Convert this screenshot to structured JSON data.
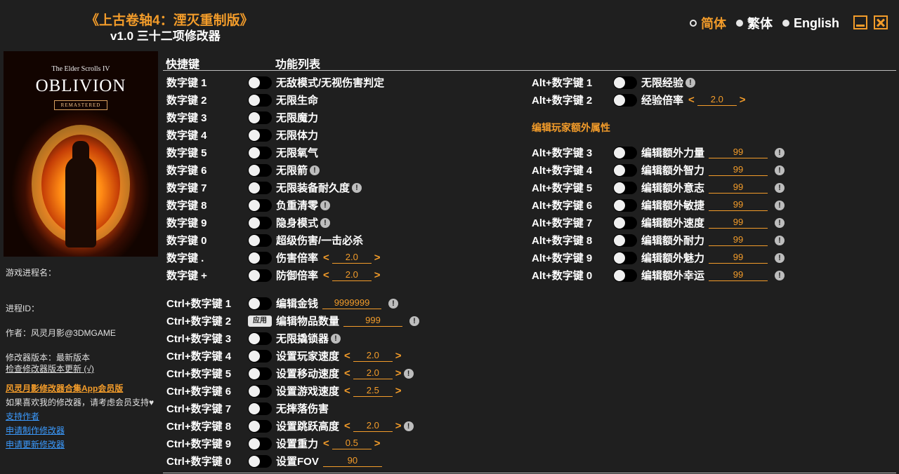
{
  "header": {
    "title": "《上古卷轴4：湮灭重制版》",
    "subtitle": "v1.0 三十二项修改器",
    "languages": [
      {
        "label": "简体",
        "active": true
      },
      {
        "label": "繁体",
        "active": false
      },
      {
        "label": "English",
        "active": false
      }
    ]
  },
  "cover": {
    "series": "The Elder Scrolls IV",
    "title": "OBLIVION",
    "badge": "REMASTERED"
  },
  "sidebar": {
    "process_name_label": "游戏进程名：",
    "process_id_label": "进程ID：",
    "author": "作者：风灵月影@3DMGAME",
    "version": "修改器版本：最新版本",
    "check_update": "检查修改器版本更新 (√)",
    "app_link": "风灵月影修改器合集App会员版",
    "support_text": "如果喜欢我的修改器，请考虑会员支持",
    "support_author": "支持作者",
    "request_make": "申请制作修改器",
    "request_update": "申请更新修改器"
  },
  "main": {
    "col_hotkey": "快捷键",
    "col_features": "功能列表",
    "section_attrs": "编辑玩家额外属性",
    "left_items": [
      {
        "key": "数字键 1",
        "label": "无敌模式/无视伤害判定"
      },
      {
        "key": "数字键 2",
        "label": "无限生命"
      },
      {
        "key": "数字键 3",
        "label": "无限魔力"
      },
      {
        "key": "数字键 4",
        "label": "无限体力"
      },
      {
        "key": "数字键 5",
        "label": "无限氧气"
      },
      {
        "key": "数字键 6",
        "label": "无限箭",
        "info": "!"
      },
      {
        "key": "数字键 7",
        "label": "无限装备耐久度",
        "info": "!"
      },
      {
        "key": "数字键 8",
        "label": "负重清零",
        "info": "!"
      },
      {
        "key": "数字键 9",
        "label": "隐身模式",
        "info": "!"
      },
      {
        "key": "数字键 0",
        "label": "超级伤害/一击必杀"
      },
      {
        "key": "数字键 .",
        "label": "伤害倍率",
        "stepper": "2.0"
      },
      {
        "key": "数字键 +",
        "label": "防御倍率",
        "stepper": "2.0"
      }
    ],
    "ctrl_items": [
      {
        "key": "Ctrl+数字键 1",
        "label": "编辑金钱",
        "input": "9999999",
        "info": "!"
      },
      {
        "key": "Ctrl+数字键 2",
        "label": "编辑物品数量",
        "input": "999",
        "info": "!",
        "apply": "应用"
      },
      {
        "key": "Ctrl+数字键 3",
        "label": "无限撬锁器",
        "info": "!"
      },
      {
        "key": "Ctrl+数字键 4",
        "label": "设置玩家速度",
        "stepper": "2.0"
      },
      {
        "key": "Ctrl+数字键 5",
        "label": "设置移动速度",
        "stepper": "2.0",
        "info": "!"
      },
      {
        "key": "Ctrl+数字键 6",
        "label": "设置游戏速度",
        "stepper": "2.5"
      },
      {
        "key": "Ctrl+数字键 7",
        "label": "无摔落伤害"
      },
      {
        "key": "Ctrl+数字键 8",
        "label": "设置跳跃高度",
        "stepper": "2.0",
        "info": "!"
      },
      {
        "key": "Ctrl+数字键 9",
        "label": "设置重力",
        "stepper": "0.5"
      },
      {
        "key": "Ctrl+数字键 0",
        "label": "设置FOV",
        "input": "90"
      }
    ],
    "alt_top": [
      {
        "key": "Alt+数字键 1",
        "label": "无限经验",
        "info": "!"
      },
      {
        "key": "Alt+数字键 2",
        "label": "经验倍率",
        "stepper": "2.0"
      }
    ],
    "alt_attrs": [
      {
        "key": "Alt+数字键 3",
        "label": "编辑额外力量",
        "input": "99",
        "info": "!"
      },
      {
        "key": "Alt+数字键 4",
        "label": "编辑额外智力",
        "input": "99",
        "info": "!"
      },
      {
        "key": "Alt+数字键 5",
        "label": "编辑额外意志",
        "input": "99",
        "info": "!"
      },
      {
        "key": "Alt+数字键 6",
        "label": "编辑额外敏捷",
        "input": "99",
        "info": "!"
      },
      {
        "key": "Alt+数字键 7",
        "label": "编辑额外速度",
        "input": "99",
        "info": "!"
      },
      {
        "key": "Alt+数字键 8",
        "label": "编辑额外耐力",
        "input": "99",
        "info": "!"
      },
      {
        "key": "Alt+数字键 9",
        "label": "编辑额外魅力",
        "input": "99",
        "info": "!"
      },
      {
        "key": "Alt+数字键 0",
        "label": "编辑额外幸运",
        "input": "99",
        "info": "!"
      }
    ]
  },
  "colors": {
    "accent": "#f39c2a",
    "background": "#1f1f1f",
    "link": "#3b9bff"
  }
}
